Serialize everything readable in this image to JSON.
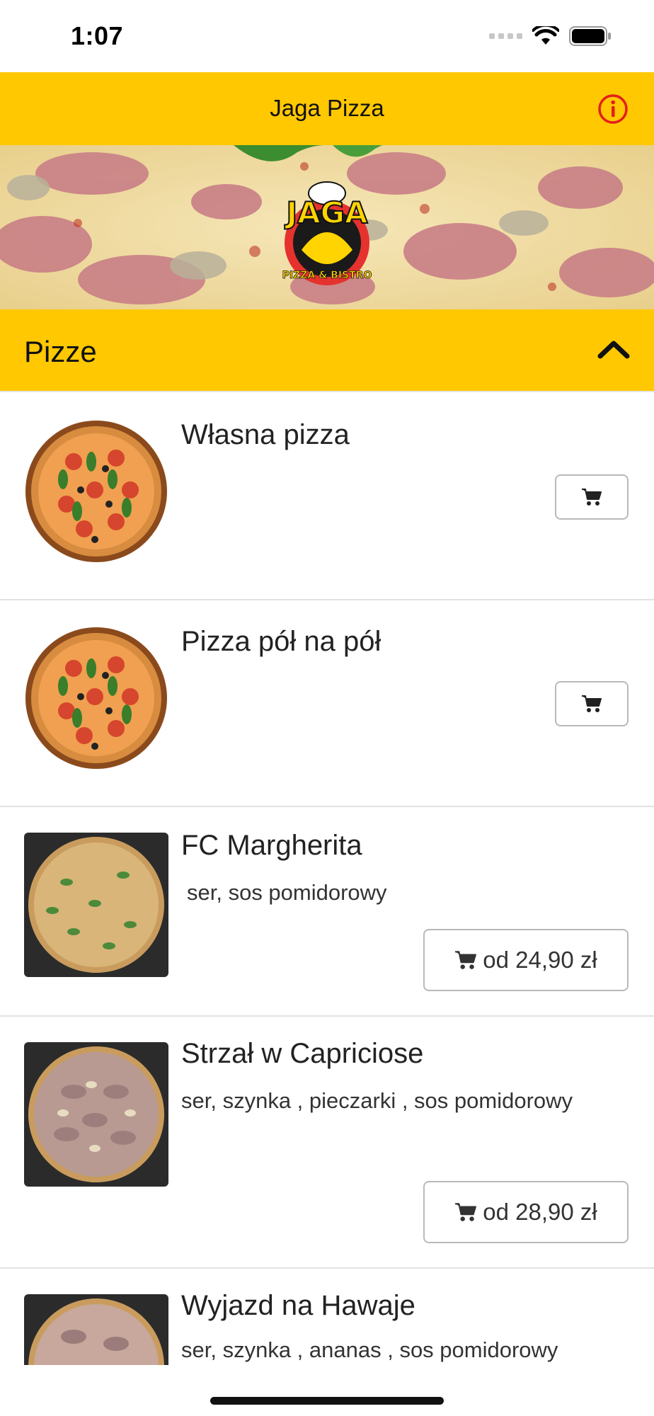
{
  "status_bar": {
    "time": "1:07"
  },
  "header": {
    "title": "Jaga Pizza",
    "info_icon": "info-icon"
  },
  "banner": {
    "logo_text": "JAGA",
    "logo_subtext": "PIZZA & BISTRO"
  },
  "category": {
    "title": "Pizze",
    "expanded": true
  },
  "items": [
    {
      "name": "Własna pizza",
      "description": "",
      "price": ""
    },
    {
      "name": "Pizza pół na pół",
      "description": "",
      "price": ""
    },
    {
      "name": "FC Margherita",
      "description": "ser, sos pomidorowy",
      "price": "od 24,90 zł"
    },
    {
      "name": "Strzał w Capriciose",
      "description": "ser, szynka , pieczarki , sos pomidorowy",
      "price": "od 28,90 zł"
    },
    {
      "name": "Wyjazd na Hawaje",
      "description": "ser, szynka , ananas , sos pomidorowy",
      "price": ""
    }
  ],
  "colors": {
    "accent": "#ffc800",
    "info_icon": "#e41e1e"
  }
}
